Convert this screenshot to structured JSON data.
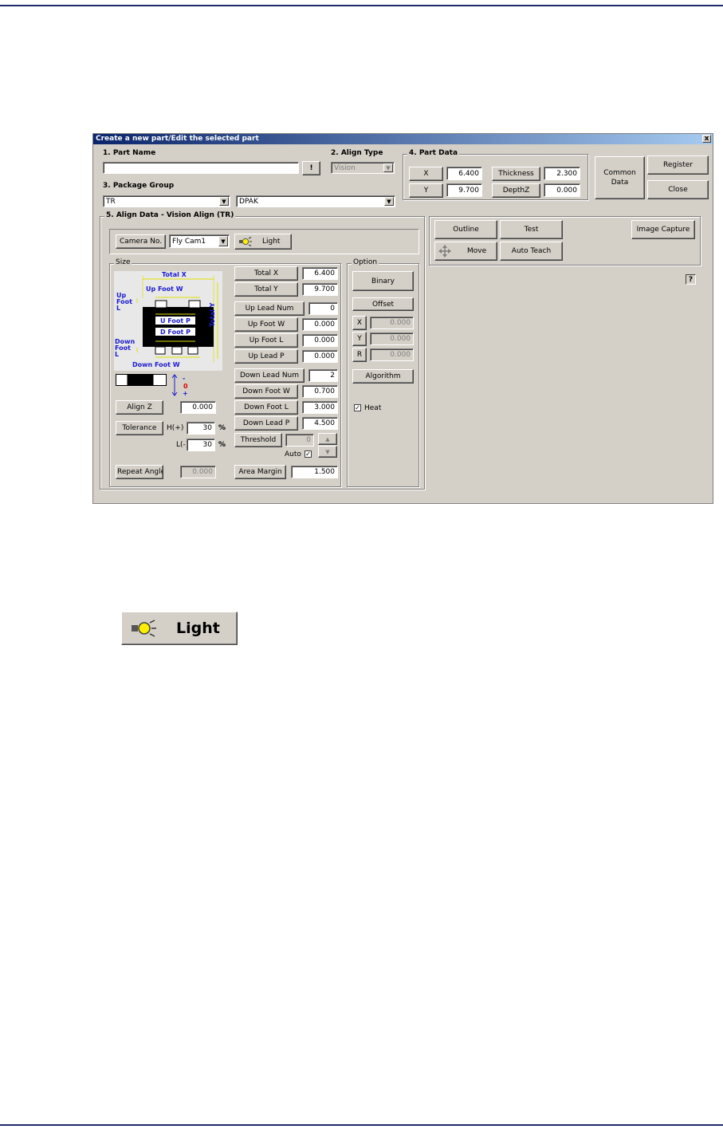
{
  "dialog": {
    "title": "Create a new part/Edit the selected part",
    "close_glyph": "x",
    "help_glyph": "?"
  },
  "part_name": {
    "label": "1. Part Name",
    "value": "",
    "browse_button": "!"
  },
  "align_type": {
    "label": "2. Align Type",
    "value": "Vision"
  },
  "part_data": {
    "label": "4. Part Data",
    "x_label": "X",
    "x_value": "6.400",
    "y_label": "Y",
    "y_value": "9.700",
    "thickness_label": "Thickness",
    "thickness_value": "2.300",
    "depthz_label": "DepthZ",
    "depthz_value": "0.000"
  },
  "actions": {
    "common_data": "Common Data",
    "register": "Register",
    "close": "Close"
  },
  "package_group": {
    "label": "3. Package Group",
    "group_value": "TR",
    "package_value": "DPAK"
  },
  "align_data": {
    "label": "5. Align Data - Vision Align (TR)",
    "camera_label": "Camera No.",
    "camera_value": "Fly Cam1",
    "light_button": "Light",
    "size": {
      "label": "Size",
      "diagram": {
        "total_x": "Total X",
        "up_foot_w": "Up Foot W",
        "up_foot_l": "Up\nFoot\nL",
        "total_y": "Total Y",
        "u_foot_p": "U Foot P",
        "d_foot_p": "D Foot P",
        "down_foot_l": "Down\nFoot\nL",
        "down_foot_w": "Down Foot W"
      },
      "dir_minus": "-",
      "dir_zero": "0",
      "dir_plus": "+",
      "align_z_label": "Align Z",
      "align_z_value": "0.000",
      "tolerance_label": "Tolerance",
      "h_label": "H(+)",
      "h_value": "30",
      "h_unit": "%",
      "l_label": "L(-)",
      "l_value": "30",
      "l_unit": "%",
      "repeat_angle_label": "Repeat Angle",
      "repeat_angle_value": "0.000",
      "fields": [
        {
          "label": "Total X",
          "value": "6.400"
        },
        {
          "label": "Total Y",
          "value": "9.700"
        },
        {
          "label": "Up Lead Num",
          "value": "0"
        },
        {
          "label": "Up Foot W",
          "value": "0.000"
        },
        {
          "label": "Up Foot L",
          "value": "0.000"
        },
        {
          "label": "Up Lead P",
          "value": "0.000"
        },
        {
          "label": "Down Lead Num",
          "value": "2"
        },
        {
          "label": "Down Foot W",
          "value": "0.700"
        },
        {
          "label": "Down Foot L",
          "value": "3.000"
        },
        {
          "label": "Down Lead P",
          "value": "4.500"
        }
      ],
      "threshold_label": "Threshold",
      "threshold_value": "0",
      "auto_label": "Auto",
      "auto_checked": true,
      "area_margin_label": "Area Margin",
      "area_margin_value": "1.500"
    },
    "option": {
      "label": "Option",
      "binary_button": "Binary",
      "offset_label": "Offset",
      "offset_x_label": "X",
      "offset_x_value": "0.000",
      "offset_y_label": "Y",
      "offset_y_value": "0.000",
      "offset_r_label": "R",
      "offset_r_value": "0.000",
      "algorithm_button": "Algorithm",
      "heat_label": "Heat",
      "heat_checked": true
    }
  },
  "tools": {
    "outline": "Outline",
    "test": "Test",
    "image_capture": "Image Capture",
    "move": "Move",
    "auto_teach": "Auto Teach"
  },
  "enlarged_light_button": {
    "label": "Light"
  },
  "colors": {
    "titlebar_start": "#0a246a",
    "titlebar_end": "#a6caf0",
    "rule_line": "#1c2b6b",
    "diagram_label": "#1a1acd",
    "bulb": "#ffee00"
  }
}
